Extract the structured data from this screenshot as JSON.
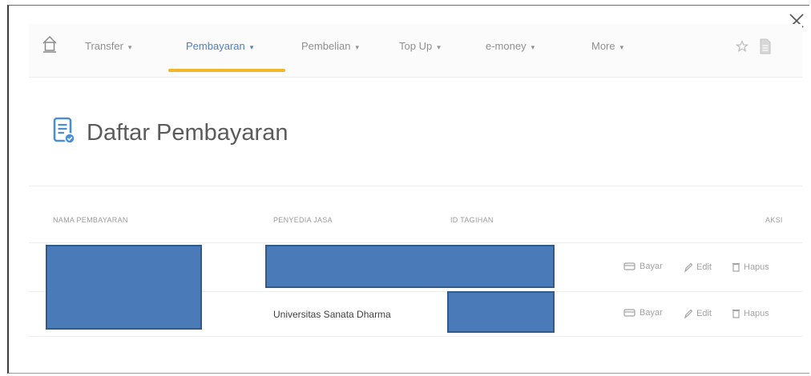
{
  "nav": {
    "items": [
      {
        "label": "Transfer"
      },
      {
        "label": "Pembayaran"
      },
      {
        "label": "Pembelian"
      },
      {
        "label": "Top Up"
      },
      {
        "label": "e-money"
      },
      {
        "label": "More"
      }
    ],
    "active_index": 1,
    "caret": "▾",
    "home_icon": "home-icon",
    "star_icon": "star-icon",
    "doc_icon": "document-icon"
  },
  "page": {
    "title": "Daftar Pembayaran",
    "icon": "payment-list-icon"
  },
  "table": {
    "headers": {
      "nama": "NAMA PEMBAYARAN",
      "penyedia": "PENYEDIA JASA",
      "id": "ID TAGIHAN",
      "aksi": "AKSI"
    },
    "rows": [
      {
        "nama": "",
        "penyedia": "",
        "id": ""
      },
      {
        "nama": "",
        "penyedia": "Universitas Sanata Dharma",
        "id": ""
      }
    ],
    "actions": {
      "pay": "Bayar",
      "edit": "Edit",
      "delete": "Hapus"
    }
  },
  "colors": {
    "accent_blue": "#4d7fc0",
    "underline_yellow": "#f3b52a",
    "redaction_blue": "#4a7ab8"
  }
}
